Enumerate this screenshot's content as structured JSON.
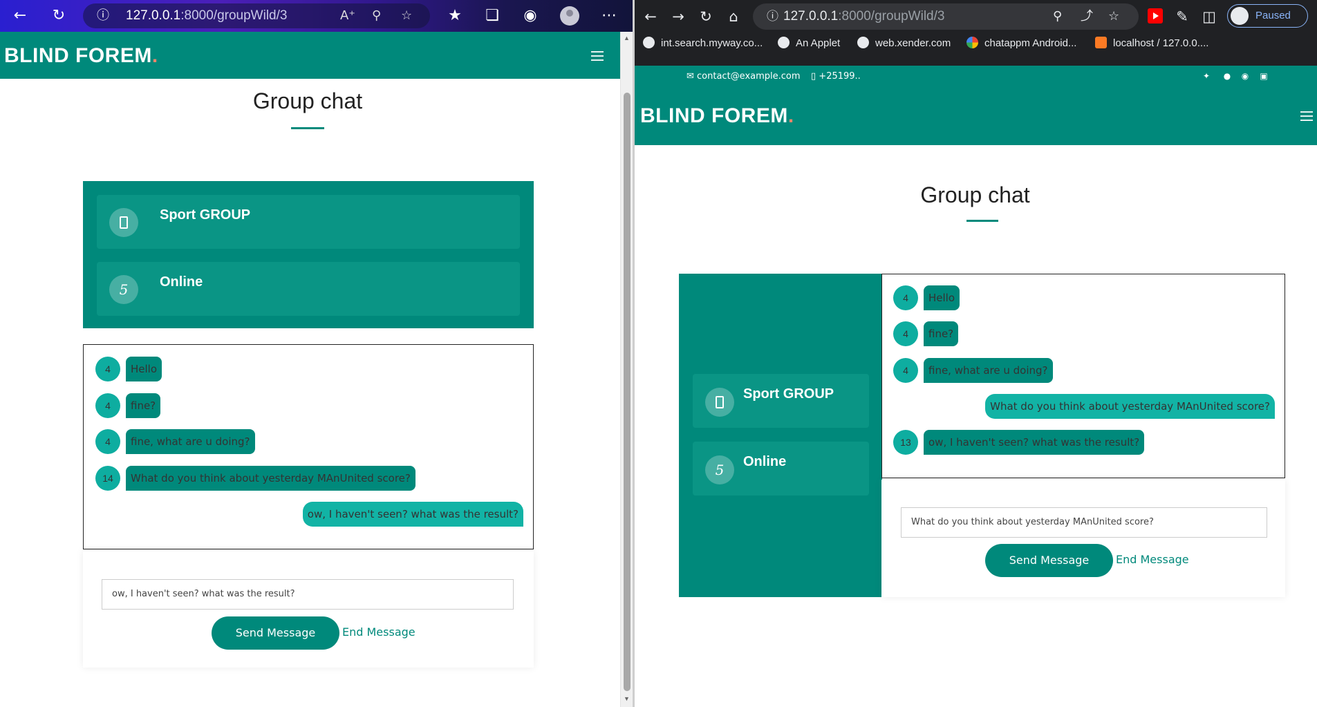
{
  "left_browser": {
    "url_host": "127.0.0.1",
    "url_rest": ":8000/groupWild/3",
    "icons": [
      "back-icon",
      "refresh-icon",
      "info-icon",
      "read-aloud-icon",
      "zoom-icon",
      "add-favorite-icon",
      "favorites-icon",
      "collections-icon",
      "ie-mode-icon",
      "profile-icon",
      "more-icon"
    ]
  },
  "left_page": {
    "brand": "BLIND FOREM",
    "brand_dot": ".",
    "title": "Group chat",
    "group_name": "Sport GROUP",
    "online_count": "5",
    "online_label": "Online",
    "messages": [
      {
        "user": "4",
        "text": "Hello",
        "mine": false
      },
      {
        "user": "4",
        "text": "fine?",
        "mine": false
      },
      {
        "user": "4",
        "text": "fine, what are u doing?",
        "mine": false
      },
      {
        "user": "14",
        "text": "What do you think about yesterday MAnUnited score?",
        "mine": false
      },
      {
        "user": "",
        "text": "ow, I haven't seen? what was the result?",
        "mine": true
      }
    ],
    "input_value": "ow, I haven't seen? what was the result?",
    "send_label": "Send Message",
    "end_label": "End Message"
  },
  "right_browser": {
    "url_host": "127.0.0.1",
    "url_rest": ":8000/groupWild/3",
    "profile_status": "Paused",
    "bookmarks": [
      {
        "label": "int.search.myway.co...",
        "icon": "globe-icon"
      },
      {
        "label": "An Applet",
        "icon": "globe-icon"
      },
      {
        "label": "web.xender.com",
        "icon": "globe-icon"
      },
      {
        "label": "chatappm Android...",
        "icon": "google-icon"
      },
      {
        "label": "localhost / 127.0.0....",
        "icon": "xampp-icon"
      }
    ]
  },
  "right_page": {
    "contact_email": "contact@example.com",
    "contact_phone": "+25199..",
    "social_icons": [
      "twitter-icon",
      "facebook-icon",
      "instagram-icon",
      "linkedin-icon"
    ],
    "brand": "BLIND FOREM",
    "brand_dot": ".",
    "title": "Group chat",
    "group_name": "Sport GROUP",
    "online_count": "5",
    "online_label": "Online",
    "messages": [
      {
        "user": "4",
        "text": "Hello",
        "mine": false
      },
      {
        "user": "4",
        "text": "fine?",
        "mine": false
      },
      {
        "user": "4",
        "text": "fine, what are u doing?",
        "mine": false
      },
      {
        "user": "",
        "text": "What do you think about yesterday MAnUnited score?",
        "mine": true
      },
      {
        "user": "13",
        "text": "ow, I haven't seen? what was the result?",
        "mine": false
      }
    ],
    "input_value": "What do you think about yesterday MAnUnited score?",
    "send_label": "Send Message",
    "end_label": "End Message"
  },
  "colors": {
    "brand_teal": "#00897b",
    "bubble_teal": "#00897b",
    "mine_bubble": "#12b3a5",
    "avatar_teal": "#0eada0",
    "brand_dot": "#f0856a"
  }
}
